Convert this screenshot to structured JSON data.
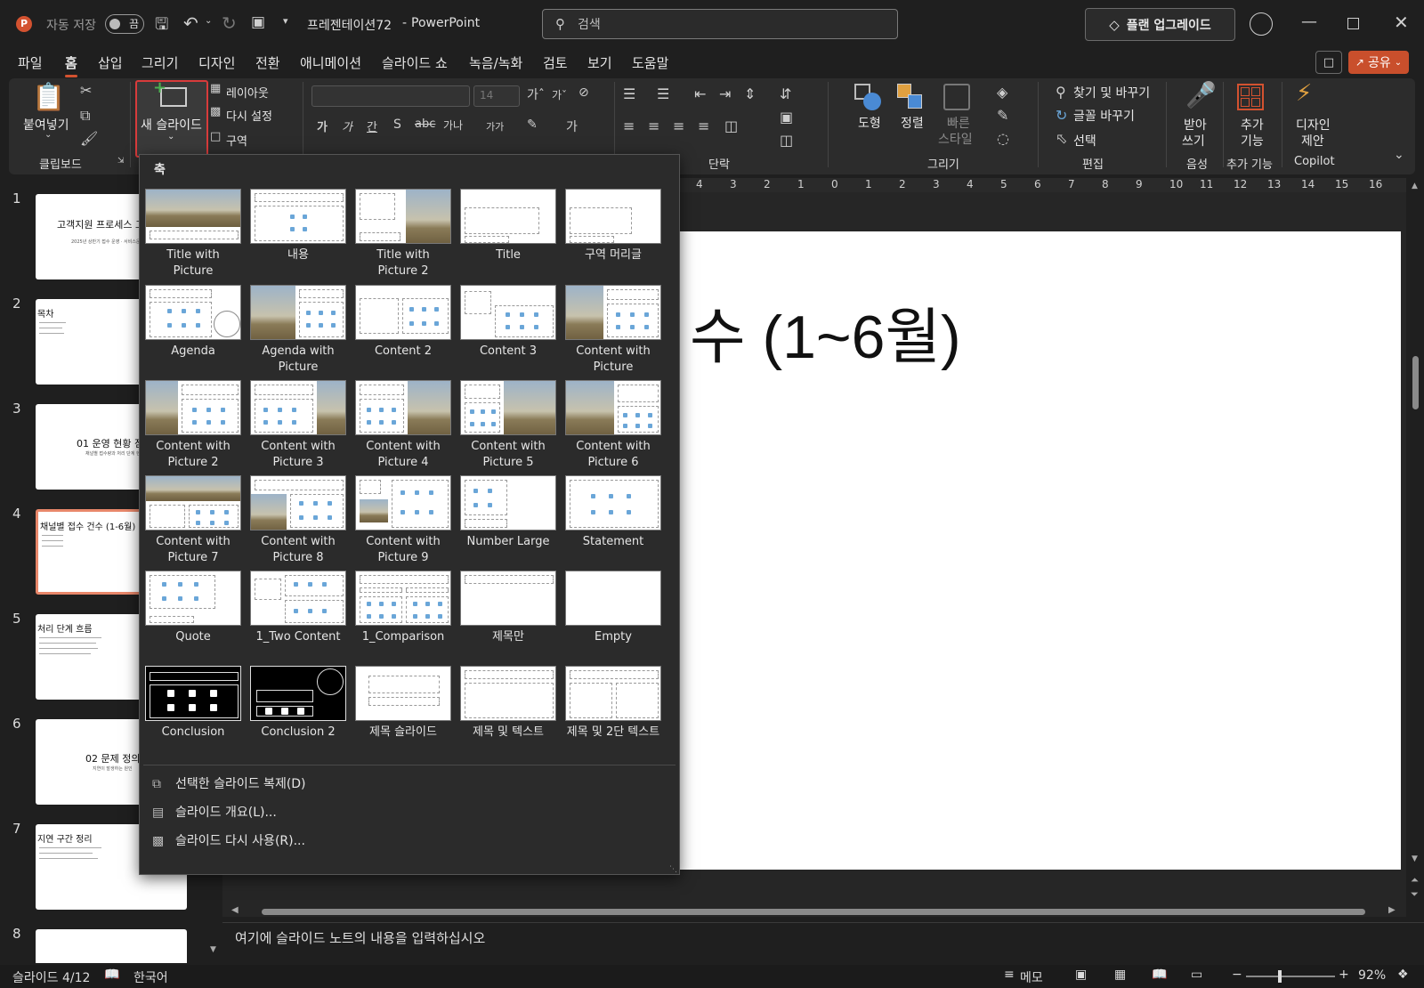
{
  "titlebar": {
    "autosave_label": "자동 저장",
    "autosave_state": "끔",
    "doc_title": "프레젠테이션72",
    "separator": "-",
    "app_name": "PowerPoint",
    "search_placeholder": "검색",
    "upgrade_label": "플랜 업그레이드"
  },
  "tabs": [
    "파일",
    "홈",
    "삽입",
    "그리기",
    "디자인",
    "전환",
    "애니메이션",
    "슬라이드 쇼",
    "녹음/녹화",
    "검토",
    "보기",
    "도움말"
  ],
  "share_label": "공유",
  "ribbon": {
    "paste": "붙여넣기",
    "clipboard": "클립보드",
    "new_slide": "새 슬라이드",
    "layout": "레이아웃",
    "reset": "다시 설정",
    "section": "구역",
    "font_size": "14",
    "paragraph": "단락",
    "shapes": "도형",
    "arrange": "정렬",
    "quick_styles_1": "빠른",
    "quick_styles_2": "스타일",
    "drawing": "그리기",
    "find_replace": "찾기 및 바꾸기",
    "replace_font": "글꼴 바꾸기",
    "select": "선택",
    "editing": "편집",
    "dictate_1": "받아",
    "dictate_2": "쓰기",
    "voice": "음성",
    "addins_1": "추가",
    "addins_2": "기능",
    "addins_group": "추가 기능",
    "designer_1": "디자인",
    "designer_2": "제안",
    "copilot": "Copilot",
    "font_btns": [
      "가",
      "가",
      "간",
      "S",
      "가나",
      "가가"
    ]
  },
  "ruler_ticks": [
    "4",
    "3",
    "2",
    "1",
    "0",
    "1",
    "2",
    "3",
    "4",
    "5",
    "6",
    "7",
    "8",
    "9",
    "10",
    "11",
    "12",
    "13",
    "14",
    "15",
    "16"
  ],
  "thumbnails": [
    {
      "num": "1",
      "title": "고객지원 프로세스 고",
      "sub": "2025년 상반기 접수 운영 · 서비스운영팀"
    },
    {
      "num": "2",
      "title": "목차"
    },
    {
      "num": "3",
      "title": "01 운영 현황 점",
      "sub": "채널별 접수량과 처리 단계 현황"
    },
    {
      "num": "4",
      "title": "채널별 접수 건수 (1-6월)"
    },
    {
      "num": "5",
      "title": "처리 단계 흐름"
    },
    {
      "num": "6",
      "title": "02 문제 정의",
      "sub": "지연이 발생하는 원인"
    },
    {
      "num": "7",
      "title": "지연 구간 정리"
    },
    {
      "num": "8",
      "title": ""
    }
  ],
  "slide": {
    "title_fragment": "수 (1~6월)"
  },
  "gallery": {
    "title": "축",
    "layouts": [
      "Title with Picture",
      "내용",
      "Title with Picture 2",
      "Title",
      "구역 머리글",
      "Agenda",
      "Agenda with Picture",
      "Content 2",
      "Content 3",
      "Content with Picture",
      "Content with Picture 2",
      "Content with Picture 3",
      "Content with Picture 4",
      "Content with Picture 5",
      "Content with Picture 6",
      "Content with Picture 7",
      "Content with Picture 8",
      "Content with Picture 9",
      "Number Large",
      "Statement",
      "Quote",
      "1_Two Content",
      "1_Comparison",
      "제목만",
      "Empty",
      "Conclusion",
      "Conclusion 2",
      "제목 슬라이드",
      "제목 및 텍스트",
      "제목 및 2단 텍스트"
    ],
    "menu": [
      "선택한 슬라이드 복제(D)",
      "슬라이드 개요(L)...",
      "슬라이드 다시 사용(R)..."
    ]
  },
  "notes_placeholder": "여기에 슬라이드 노트의 내용을 입력하십시오",
  "status": {
    "slide_count": "슬라이드 4/12",
    "language": "한국어",
    "notes": "메모",
    "zoom": "92%"
  },
  "colors": {
    "accent": "#d35230",
    "share": "#c94f2c",
    "highlight": "#d83b3b"
  }
}
